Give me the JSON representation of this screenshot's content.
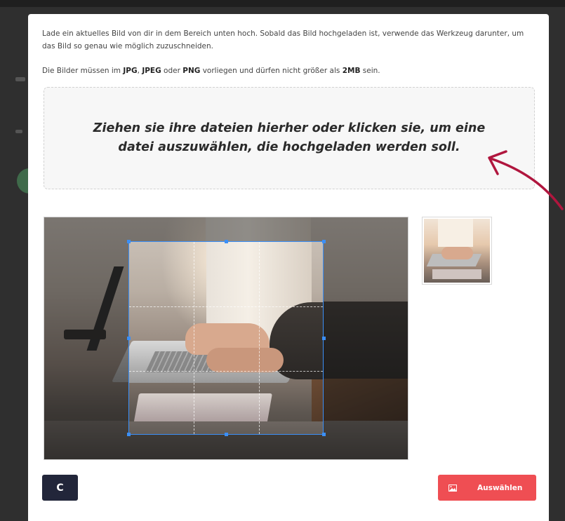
{
  "modal": {
    "intro": "Lade ein aktuelles Bild von dir in dem Bereich unten hoch. Sobald das Bild hochgeladen ist, verwende das Werkzeug darunter, um das Bild so genau wie möglich zuzuschneiden.",
    "rules": {
      "prefix": "Die Bilder müssen im ",
      "jpg": "JPG",
      "sep1": ", ",
      "jpeg": "JPEG",
      "mid": " oder ",
      "png": "PNG",
      "middle": " vorliegen und dürfen nicht größer als ",
      "size": "2MB",
      "suffix": " sein."
    },
    "dropzone": {
      "text": "Ziehen sie ihre dateien hierher oder klicken sie, um eine datei auszuwählen, die hochgeladen werden soll."
    },
    "buttons": {
      "reset_label": "C",
      "select_label": "Auswählen"
    }
  },
  "icons": {
    "reset": "rotate-icon",
    "select": "image-icon"
  },
  "colors": {
    "primary": "#ef4e53",
    "dark_button": "#22263a",
    "crop_guide": "#3b8ff7",
    "annotation_arrow": "#b0163e"
  }
}
